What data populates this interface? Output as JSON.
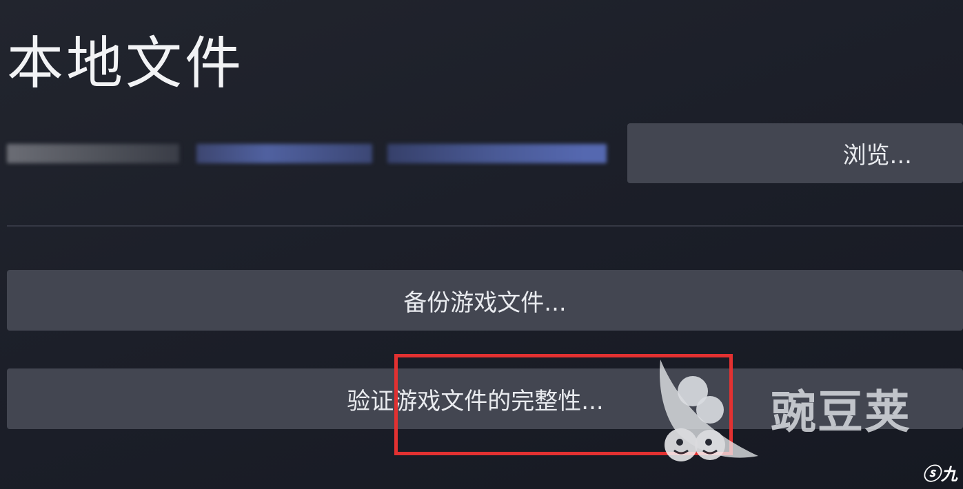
{
  "title": "本地文件",
  "buttons": {
    "browse": "浏览...",
    "backup": "备份游戏文件...",
    "verify": "验证游戏文件的完整性..."
  },
  "watermarks": {
    "main": "豌豆荚",
    "corner": "九游"
  },
  "colors": {
    "button_bg": "#434651",
    "highlight": "#e23131",
    "background": "#1c1f29"
  }
}
